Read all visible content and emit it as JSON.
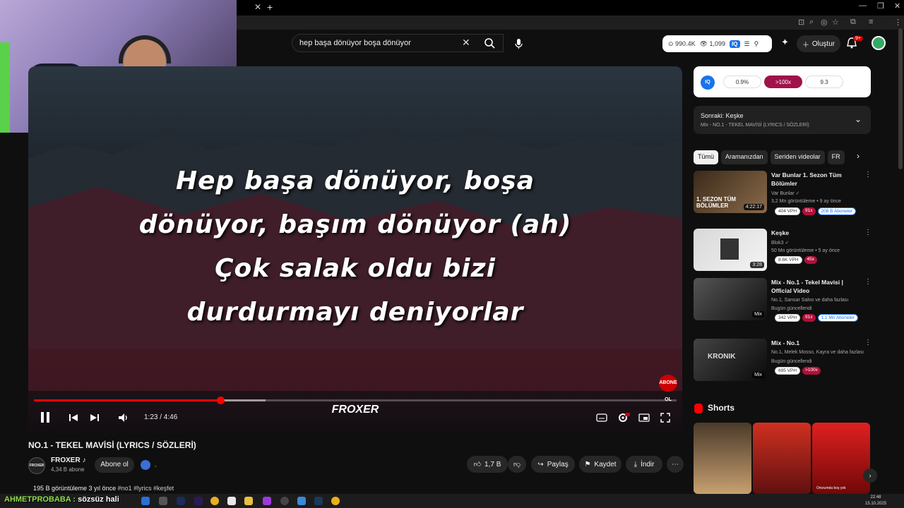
{
  "search": {
    "query": "hep başa dönüyor boşa dönüyor"
  },
  "stats_pill": {
    "views": "990.4K",
    "eyes": "1,099",
    "iq": "IQ"
  },
  "header": {
    "create_label": "Oluştur",
    "notif_count": "9+"
  },
  "player": {
    "lyrics": [
      "Hep başa dönüyor, boşa",
      "dönüyor, başım dönüyor (ah)",
      "Çok salak oldu bizi",
      "durdurmayı deniyorlar"
    ],
    "watermark": "FROXER",
    "abone_badge": "ABONE OL",
    "time": "1:23 / 4:46",
    "progress_played": 0.29,
    "progress_buffered": 0.36
  },
  "video": {
    "title": "NO.1 - TEKEL MAVİSİ (LYRICS / SÖZLERİ)",
    "channel": "FROXER ♪",
    "channel_avatar": "FROXER",
    "subscribers": "4,34 B abone",
    "subscribe_label": "Abone ol",
    "like_count": "1,7 B",
    "share_label": "Paylaş",
    "save_label": "Kaydet",
    "download_label": "İndir",
    "views_time": "195 B görüntüleme  3 yıl önce",
    "tags": "#no1 #lyrics #keşfet"
  },
  "iq_panel": {
    "badge": "IQ",
    "v1": "0.9%",
    "v2": ">100x",
    "v3": "9.3"
  },
  "next_panel": {
    "title": "Sonraki: Keşke",
    "subtitle": "Mix - NO.1 - TEKEL MAVİSİ (LYRICS / SÖZLERİ)"
  },
  "chips": [
    "Tümü",
    "Aramanızdan",
    "Seriden videolar",
    "FR"
  ],
  "recommendations": [
    {
      "title": "Var Bunlar 1. Sezon Tüm Bölümler",
      "channel": "Var Bunlar ✓",
      "meta": "3,2 Mn görüntüleme • 9 ay önce",
      "duration": "4:22:17",
      "thumb_text": "1. SEZON TÜM BÖLÜMLER",
      "badges": [
        "404 VPH",
        "91x",
        "208 B Aboneler"
      ]
    },
    {
      "title": "Keşke",
      "channel": "Blok3 ✓",
      "meta": "50 Mn görüntüleme • 5 ay önce",
      "duration": "3:28",
      "badges": [
        "8.6K VPH",
        "45x"
      ]
    },
    {
      "title": "Mix - No.1 - Tekel Mavisi | Official Video",
      "channel": "No.1, Sansar Salvo ve daha fazlası",
      "meta": "Bugün güncellendi",
      "duration": "Mix",
      "badges": [
        "342 VPH",
        "91x",
        "1,1 Mn Aboneler"
      ]
    },
    {
      "title": "Mix - No.1",
      "channel": "No.1, Melek Mosso, Kayra ve daha fazlası",
      "meta": "Bugün güncellendi",
      "duration": "Mix",
      "thumb_text": "KRONIK",
      "badges": [
        "695 VPH",
        ">100x"
      ]
    }
  ],
  "shorts": {
    "title": "Shorts",
    "caption": "Omzumda boş yok"
  },
  "taskbar": {
    "marquee_user": "AHMETPROBABA :",
    "marquee_text": " sözsüz hali",
    "time": "22:48",
    "date": "15.10.2025"
  }
}
